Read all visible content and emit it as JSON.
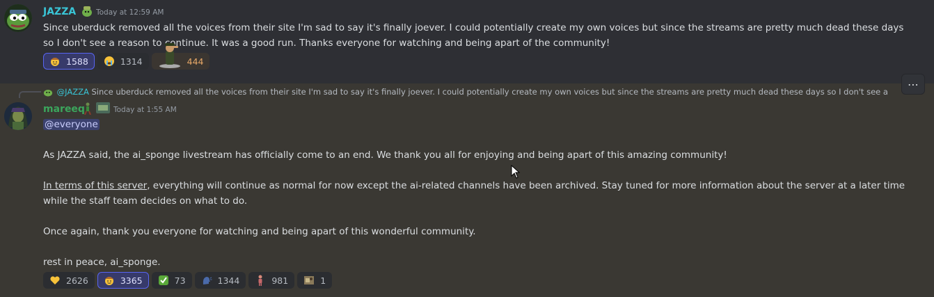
{
  "message1": {
    "username": "JAZZA",
    "timestamp": "Today at 12:59 AM",
    "text_line1": "Since uberduck removed all the voices from their site I'm sad to say it's finally joever. I could potentially create my own voices but since the streams are pretty much dead these days",
    "text_line2": "so I don't see a reason to continue. It was a good run. Thanks everyone for watching and being apart of the community!",
    "reactions": [
      {
        "emoji": "cowboy-face",
        "count": "1588",
        "me": true
      },
      {
        "emoji": "crying-face",
        "count": "1314",
        "me": false
      },
      {
        "emoji": "salute-man",
        "count": "444",
        "me": false
      }
    ]
  },
  "message2": {
    "reply": {
      "username": "@JAZZA",
      "text": "Since uberduck removed all the voices from their site I'm sad to say it's finally joever. I could potentially create my own voices but since the streams are pretty much dead these days so I don't see a"
    },
    "username": "mareeq",
    "timestamp": "Today at 1:55 AM",
    "mention": "@everyone",
    "para1": "As JAZZA said, the ai_sponge livestream has officially come to an end. We thank you all for enjoying and being apart of this amazing community!",
    "para2_underlined": "In terms of this server",
    "para2_rest_line1": ", everything will continue as normal for now except the ai-related channels have been archived. Stay tuned for more information about the server at a later time",
    "para2_line2": "while the staff team decides on what to do.",
    "para3": "Once again, thank you everyone for watching and being apart of this wonderful community.",
    "para4": "rest in peace, ai_sponge.",
    "reactions": [
      {
        "emoji": "yellow-heart",
        "count": "2626",
        "me": false
      },
      {
        "emoji": "cowboy-face",
        "count": "3365",
        "me": true
      },
      {
        "emoji": "check-mark",
        "count": "73",
        "me": false
      },
      {
        "emoji": "speaking-head",
        "count": "1344",
        "me": false
      },
      {
        "emoji": "figure",
        "count": "981",
        "me": false
      },
      {
        "emoji": "custom-image",
        "count": "1",
        "me": false
      }
    ]
  },
  "more_button": "⋯"
}
